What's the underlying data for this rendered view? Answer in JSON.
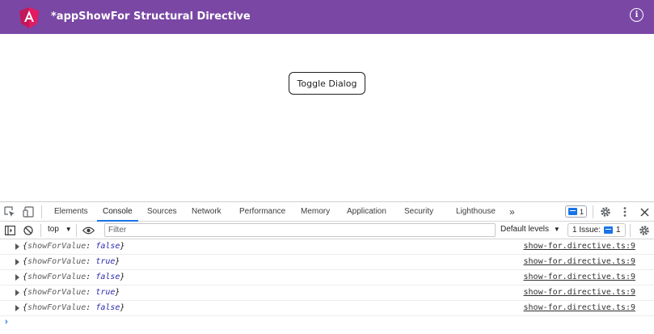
{
  "app": {
    "title": "*appShowFor Structural Directive",
    "info_glyph": "i",
    "header_color": "#7a47a5"
  },
  "main": {
    "toggle_label": "Toggle Dialog"
  },
  "devtools": {
    "tabs": [
      {
        "label": "Elements"
      },
      {
        "label": "Console"
      },
      {
        "label": "Sources"
      },
      {
        "label": "Network"
      },
      {
        "label": "Performance"
      },
      {
        "label": "Memory"
      },
      {
        "label": "Application"
      },
      {
        "label": "Security"
      },
      {
        "label": "Lighthouse"
      }
    ],
    "more_tabs_glyph": "»",
    "messages_badge_count": "1",
    "toolbar": {
      "context": "top",
      "filter_placeholder": "Filter",
      "levels": "Default levels",
      "issues_label": "1 Issue:",
      "issues_count": "1"
    },
    "logs": [
      {
        "key": "showForValue",
        "value": "false",
        "source": "show-for.directive.ts:9"
      },
      {
        "key": "showForValue",
        "value": "true",
        "source": "show-for.directive.ts:9"
      },
      {
        "key": "showForValue",
        "value": "false",
        "source": "show-for.directive.ts:9"
      },
      {
        "key": "showForValue",
        "value": "true",
        "source": "show-for.directive.ts:9"
      },
      {
        "key": "showForValue",
        "value": "false",
        "source": "show-for.directive.ts:9"
      }
    ],
    "prompt_glyph": "›"
  }
}
